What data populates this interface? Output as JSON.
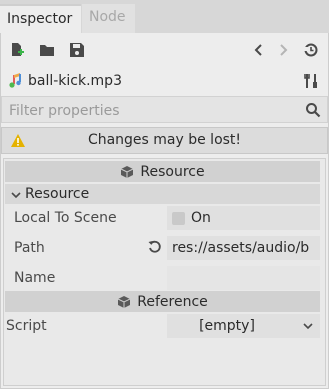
{
  "tabs": {
    "inspector": "Inspector",
    "node": "Node"
  },
  "toolbar": {
    "new_icon": "new-resource-icon",
    "open_icon": "folder-open-icon",
    "save_icon": "save-icon",
    "back_icon": "chevron-left-icon",
    "forward_icon": "chevron-right-icon",
    "history_icon": "history-icon"
  },
  "resource": {
    "name": "ball-kick.mp3",
    "icon": "audio-file-icon",
    "tools_icon": "tools-icon"
  },
  "filter": {
    "placeholder": "Filter properties",
    "icon": "search-icon"
  },
  "warning": {
    "text": "Changes may be lost!",
    "icon": "warning-icon",
    "color": "#e5b200"
  },
  "sections": {
    "resource_header": "Resource",
    "resource_subsection": "Resource",
    "reference_header": "Reference"
  },
  "properties": {
    "local_to_scene": {
      "label": "Local To Scene",
      "value": "On"
    },
    "path": {
      "label": "Path",
      "value": "res://assets/audio/b"
    },
    "name": {
      "label": "Name",
      "value": ""
    },
    "script": {
      "label": "Script",
      "value": "[empty]"
    }
  }
}
